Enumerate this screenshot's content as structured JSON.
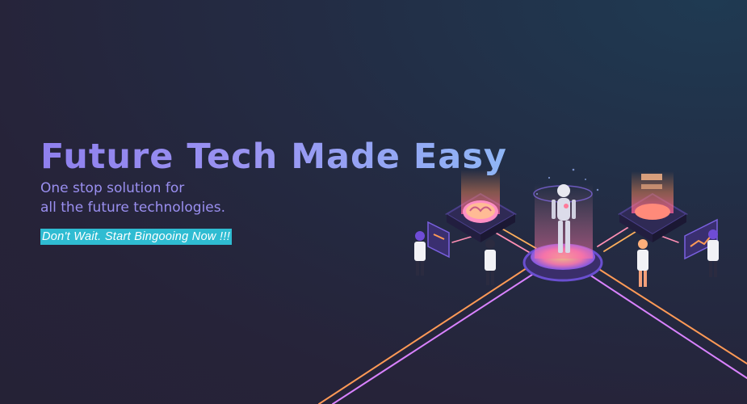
{
  "hero": {
    "headline": "Future Tech Made Easy",
    "subline_1": "One stop solution for",
    "subline_2": "all the future technologies.",
    "cta": "Don't Wait. Start Bingooing Now !!!"
  },
  "colors": {
    "headline_gradient": [
      "#8f80ee",
      "#8fb6f6"
    ],
    "subline": "#9a8ff0",
    "cta_background": "#2fbcd2",
    "cta_text": "#ffffff",
    "background": "#252236"
  },
  "illustration": {
    "icons": [
      "robot-icon",
      "brain-hologram-icon",
      "data-server-icon",
      "scientist-icon",
      "screen-panel-icon"
    ]
  }
}
